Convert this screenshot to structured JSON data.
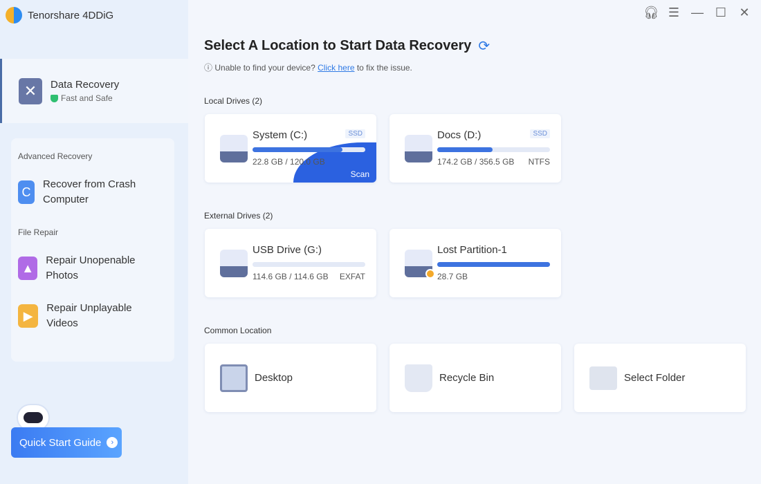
{
  "app": {
    "title": "Tenorshare 4DDiG"
  },
  "sidebar": {
    "data_recovery": {
      "title": "Data Recovery",
      "subtitle": "Fast and Safe"
    },
    "advanced_label": "Advanced Recovery",
    "crash_label": "Recover from Crash Computer",
    "file_repair_label": "File Repair",
    "photos_label": "Repair Unopenable Photos",
    "videos_label": "Repair Unplayable Videos",
    "quick_start": "Quick Start Guide"
  },
  "main": {
    "title": "Select A Location to Start Data Recovery",
    "hint_before": "Unable to find your device?",
    "hint_link": "Click here",
    "hint_after": "to fix the issue.",
    "local_label": "Local Drives (2)",
    "external_label": "External Drives (2)",
    "common_label": "Common Location",
    "drives": [
      {
        "name": "System (C:)",
        "tag": "SSD",
        "size": "22.8 GB / 120.0 GB",
        "fs": "",
        "fill_pct": 80,
        "action": "Scan"
      },
      {
        "name": "Docs (D:)",
        "tag": "SSD",
        "size": "174.2 GB / 356.5 GB",
        "fs": "NTFS",
        "fill_pct": 49
      },
      {
        "name": "USB Drive (G:)",
        "tag": "",
        "size": "114.6 GB / 114.6 GB",
        "fs": "EXFAT",
        "fill_pct": 0
      },
      {
        "name": "Lost Partition-1",
        "tag": "",
        "size": "28.7 GB",
        "fs": "",
        "fill_pct": 100
      }
    ],
    "locations": [
      {
        "label": "Desktop"
      },
      {
        "label": "Recycle Bin"
      },
      {
        "label": "Select Folder"
      }
    ]
  },
  "colors": {
    "accent": "#3d73e0",
    "sidebar": "#e8f0fb"
  }
}
